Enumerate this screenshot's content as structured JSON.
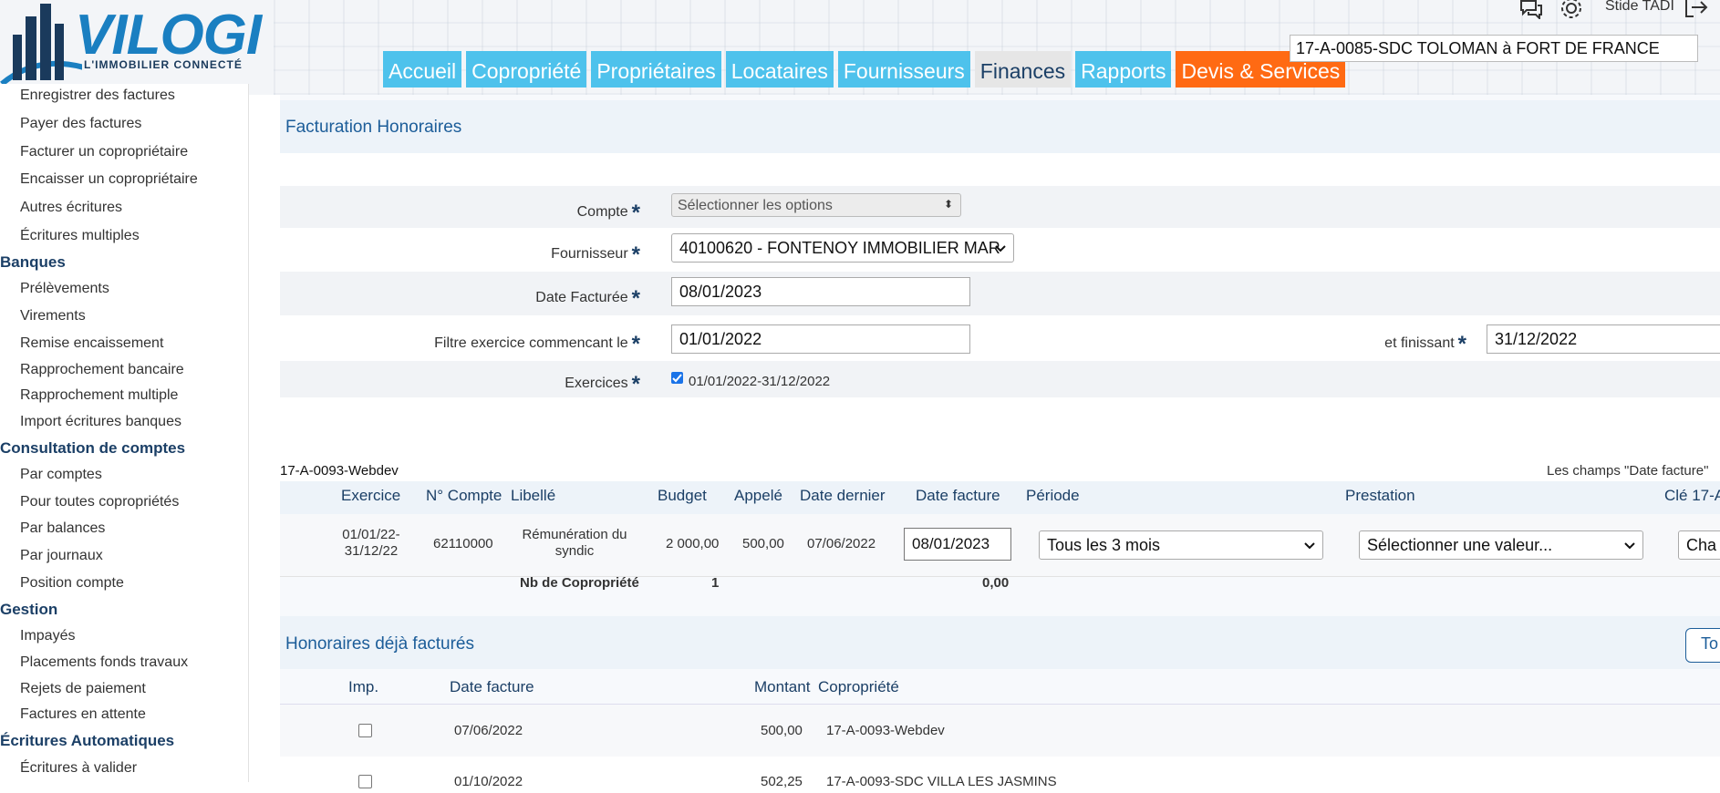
{
  "header": {
    "logo_text": "VILOGI",
    "logo_tagline": "L'IMMOBILIER CONNECTÉ",
    "user_name": "Stide TADI",
    "condo_selected": "17-A-0085-SDC TOLOMAN à FORT DE FRANCE",
    "nav": [
      {
        "label": "Accueil"
      },
      {
        "label": "Copropriété"
      },
      {
        "label": "Propriétaires"
      },
      {
        "label": "Locataires"
      },
      {
        "label": "Fournisseurs"
      },
      {
        "label": "Finances"
      },
      {
        "label": "Rapports"
      },
      {
        "label": "Devis & Services"
      }
    ]
  },
  "sidebar": {
    "items_top": [
      "Enregistrer des factures",
      "Payer des factures",
      "Facturer un copropriétaire",
      "Encaisser un copropriétaire",
      "Autres écritures",
      "Écritures multiples"
    ],
    "banques": {
      "title": "Banques",
      "items": [
        "Prélèvements",
        "Virements",
        "Remise encaissement",
        "Rapprochement bancaire",
        "Rapprochement multiple",
        "Import écritures banques"
      ]
    },
    "consultation": {
      "title": "Consultation de comptes",
      "items": [
        "Par comptes",
        "Pour toutes copropriétés",
        "Par balances",
        "Par journaux",
        "Position compte"
      ]
    },
    "gestion": {
      "title": "Gestion",
      "items": [
        "Impayés",
        "Placements fonds travaux",
        "Rejets de paiement",
        "Factures en attente"
      ]
    },
    "ecritures_auto": {
      "title": "Écritures Automatiques",
      "items": [
        "Écritures à valider"
      ]
    }
  },
  "form": {
    "title": "Facturation Honoraires",
    "compte_label": "Compte",
    "compte_placeholder": "Sélectionner les options",
    "fournisseur_label": "Fournisseur",
    "fournisseur_value": "40100620 - FONTENOY IMMOBILIER MAR",
    "date_facturee_label": "Date Facturée",
    "date_facturee_value": "08/01/2023",
    "filtre_label": "Filtre exercice commencant le",
    "filtre_value": "01/01/2022",
    "finissant_label": "et finissant",
    "finissant_value": "31/12/2022",
    "exercices_label": "Exercices",
    "exercice_option": "01/01/2022-31/12/2022",
    "required_mark": "*"
  },
  "table": {
    "group_title": "17-A-0093-Webdev",
    "note": "Les champs \"Date facture\"",
    "headers": {
      "exercice": "Exercice",
      "compte": "N° Compte",
      "libelle": "Libellé",
      "budget": "Budget",
      "appele": "Appelé",
      "date_dernier": "Date dernier",
      "date_facture": "Date facture",
      "periode": "Période",
      "prestation": "Prestation",
      "cle": "Clé 17-A"
    },
    "row": {
      "exercice_line1": "01/01/22-",
      "exercice_line2": "31/12/22",
      "compte": "62110000",
      "libelle_line1": "Rémunération du",
      "libelle_line2": "syndic",
      "budget": "2 000,00",
      "appele": "500,00",
      "date_dernier": "07/06/2022",
      "date_facture": "08/01/2023",
      "periode": "Tous les 3 mois",
      "prestation": "Sélectionner une valeur...",
      "cle": "Cha"
    },
    "footer": {
      "label": "Nb de Copropriété",
      "count": "1",
      "total": "0,00"
    }
  },
  "already": {
    "title": "Honoraires déjà facturés",
    "button_label": "To",
    "headers": {
      "imp": "Imp.",
      "date": "Date facture",
      "montant": "Montant",
      "copro": "Copropriété"
    },
    "rows": [
      {
        "date": "07/06/2022",
        "montant": "500,00",
        "copro": "17-A-0093-Webdev"
      },
      {
        "date": "01/10/2022",
        "montant": "502,25",
        "copro": "17-A-0093-SDC VILLA LES JASMINS"
      }
    ]
  },
  "colors": {
    "nav_blue": "#4ec2ec",
    "nav_orange": "#ff6a13",
    "title_blue": "#1c5d99",
    "dark_navy": "#1b3f66"
  }
}
